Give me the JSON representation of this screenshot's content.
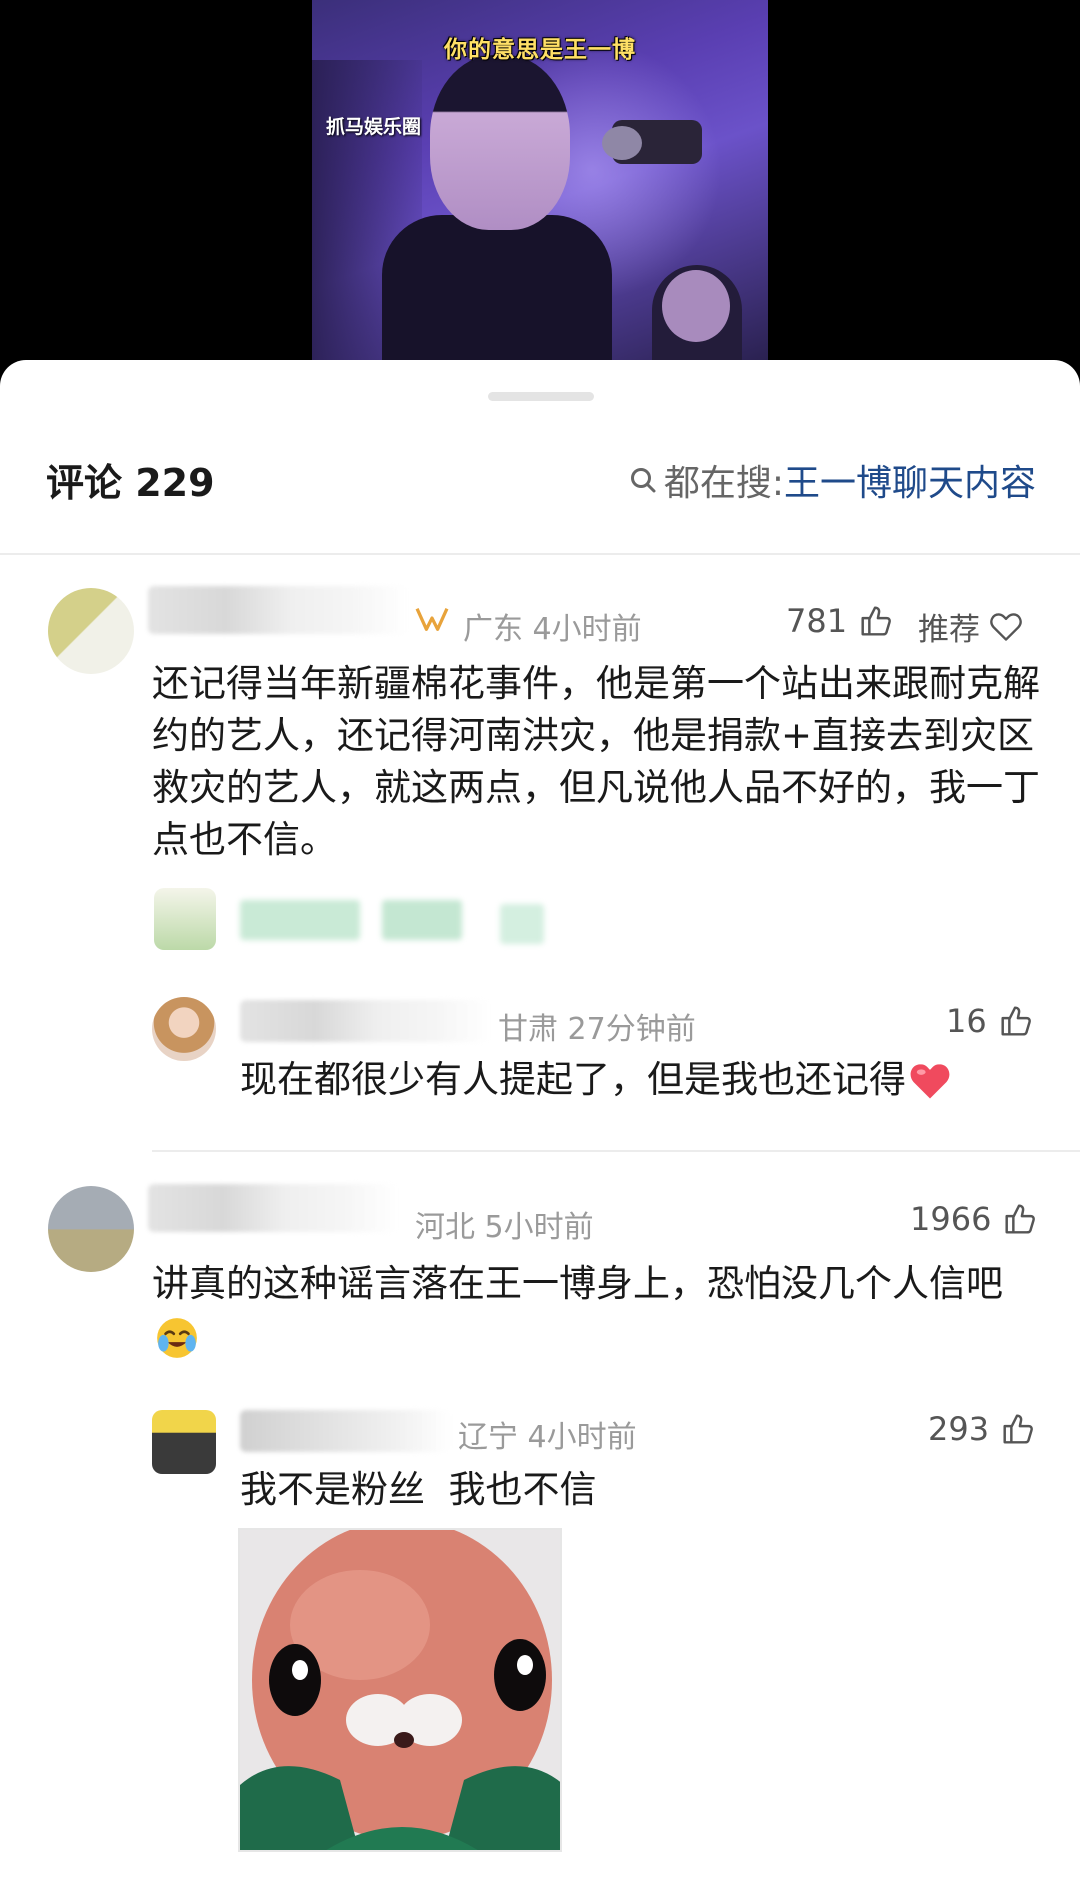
{
  "video": {
    "caption": "你的意思是王一博",
    "watermark": "抓马娱乐圈"
  },
  "header": {
    "title": "评论 229",
    "search_label": "都在搜:",
    "search_term": "王一博聊天内容"
  },
  "comments": [
    {
      "location_time": "广东 4小时前",
      "likes": "781",
      "recommend_label": "推荐",
      "text": "还记得当年新疆棉花事件，他是第一个站出来跟耐克解约的艺人，还记得河南洪灾，他是捐款+直接去到灾区救灾的艺人，就这两点，但凡说他人品不好的，我一丁点也不信。",
      "replies": [
        {
          "location_time": "甘肃 27分钟前",
          "likes": "16",
          "text": "现在都很少有人提起了，但是我也还记得",
          "emoji": "heart-icon"
        }
      ]
    },
    {
      "location_time": "河北 5小时前",
      "likes": "1966",
      "text": "讲真的这种谣言落在王一博身上，恐怕没几个人信吧",
      "emoji": "crying-laughing-icon",
      "replies": [
        {
          "location_time": "辽宁 4小时前",
          "likes": "293",
          "text": "我不是粉丝  我也不信",
          "sticker": "peach-doll-sticker"
        }
      ]
    }
  ],
  "colors": {
    "search_term": "#1f4a8a",
    "meta_gray": "#9a9a9a",
    "heart": "#f04a5e"
  }
}
